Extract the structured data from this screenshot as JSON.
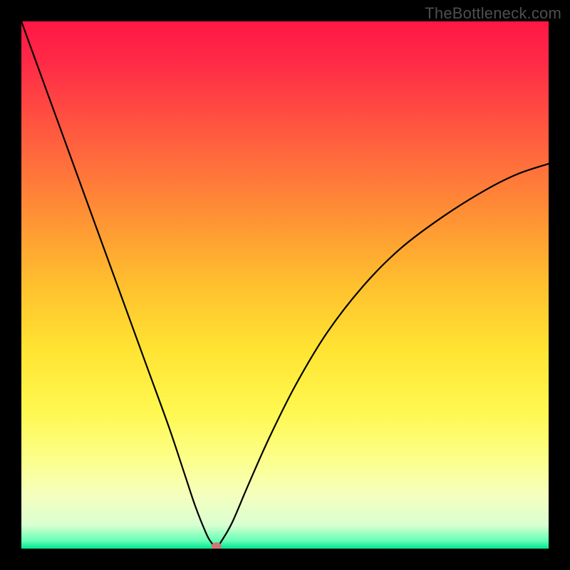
{
  "watermark": "TheBottleneck.com",
  "colors": {
    "frame": "#000000",
    "curve": "#000000",
    "dot": "#cf7772",
    "gradient_stops": [
      {
        "offset": 0.0,
        "color": "#ff1744"
      },
      {
        "offset": 0.08,
        "color": "#ff2b47"
      },
      {
        "offset": 0.2,
        "color": "#ff5640"
      },
      {
        "offset": 0.35,
        "color": "#ff8a36"
      },
      {
        "offset": 0.5,
        "color": "#ffc02e"
      },
      {
        "offset": 0.62,
        "color": "#ffe332"
      },
      {
        "offset": 0.74,
        "color": "#fff850"
      },
      {
        "offset": 0.83,
        "color": "#fcff8a"
      },
      {
        "offset": 0.9,
        "color": "#f4ffbf"
      },
      {
        "offset": 0.955,
        "color": "#d9ffd0"
      },
      {
        "offset": 0.985,
        "color": "#66ffb7"
      },
      {
        "offset": 1.0,
        "color": "#00e58f"
      }
    ]
  },
  "chart_data": {
    "type": "line",
    "title": "",
    "xlabel": "",
    "ylabel": "",
    "x_range": [
      0,
      100
    ],
    "y_range": [
      0,
      100
    ],
    "optimum_x": 37,
    "optimum_y": 0,
    "marker": {
      "x": 37,
      "y": 0.5
    },
    "series": [
      {
        "name": "bottleneck-curve",
        "x": [
          0,
          4,
          8,
          12,
          16,
          20,
          24,
          28,
          31,
          33,
          35,
          36,
          37,
          38,
          40,
          43,
          47,
          52,
          58,
          65,
          72,
          80,
          88,
          94,
          100
        ],
        "y": [
          100,
          89,
          78,
          67,
          56,
          45,
          34,
          23,
          14,
          8,
          3,
          1.2,
          0.3,
          1.5,
          5,
          12,
          21,
          31,
          41,
          50,
          57,
          63,
          68,
          71,
          73
        ]
      }
    ]
  }
}
